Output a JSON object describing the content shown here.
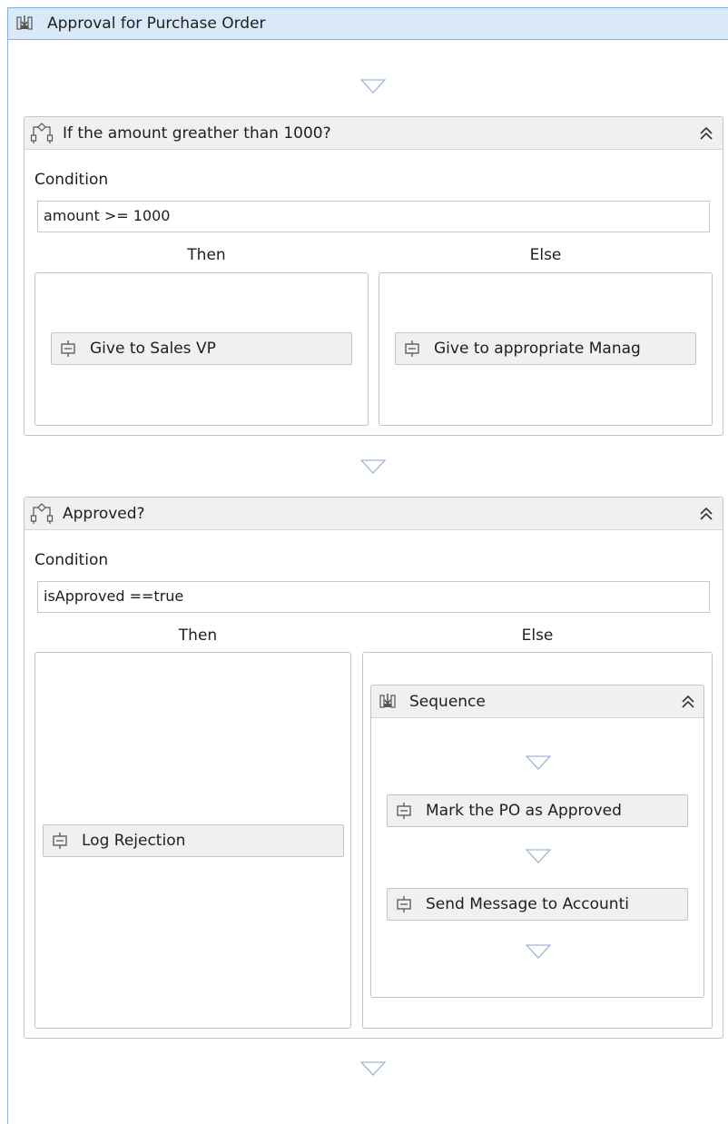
{
  "workflow": {
    "title": "Approval for Purchase Order"
  },
  "if_amount": {
    "title": "If the amount greather than 1000?",
    "condition_label": "Condition",
    "condition_value": "amount >= 1000",
    "then_label": "Then",
    "else_label": "Else",
    "then_activity": "Give to Sales VP",
    "else_activity": "Give to appropriate Manag"
  },
  "if_approved": {
    "title": "Approved?",
    "condition_label": "Condition",
    "condition_value": "isApproved ==true",
    "then_label": "Then",
    "else_label": "Else",
    "then_activity": "Log Rejection",
    "sequence": {
      "title": "Sequence",
      "activities": [
        "Mark the PO as Approved",
        "Send Message to Accounti"
      ]
    }
  },
  "colors": {
    "header_blue": "#dae9f9",
    "border_blue": "#7fb2e3",
    "block_header_gray": "#f0f0f0",
    "arrow_blue": "#9fb8d6"
  }
}
